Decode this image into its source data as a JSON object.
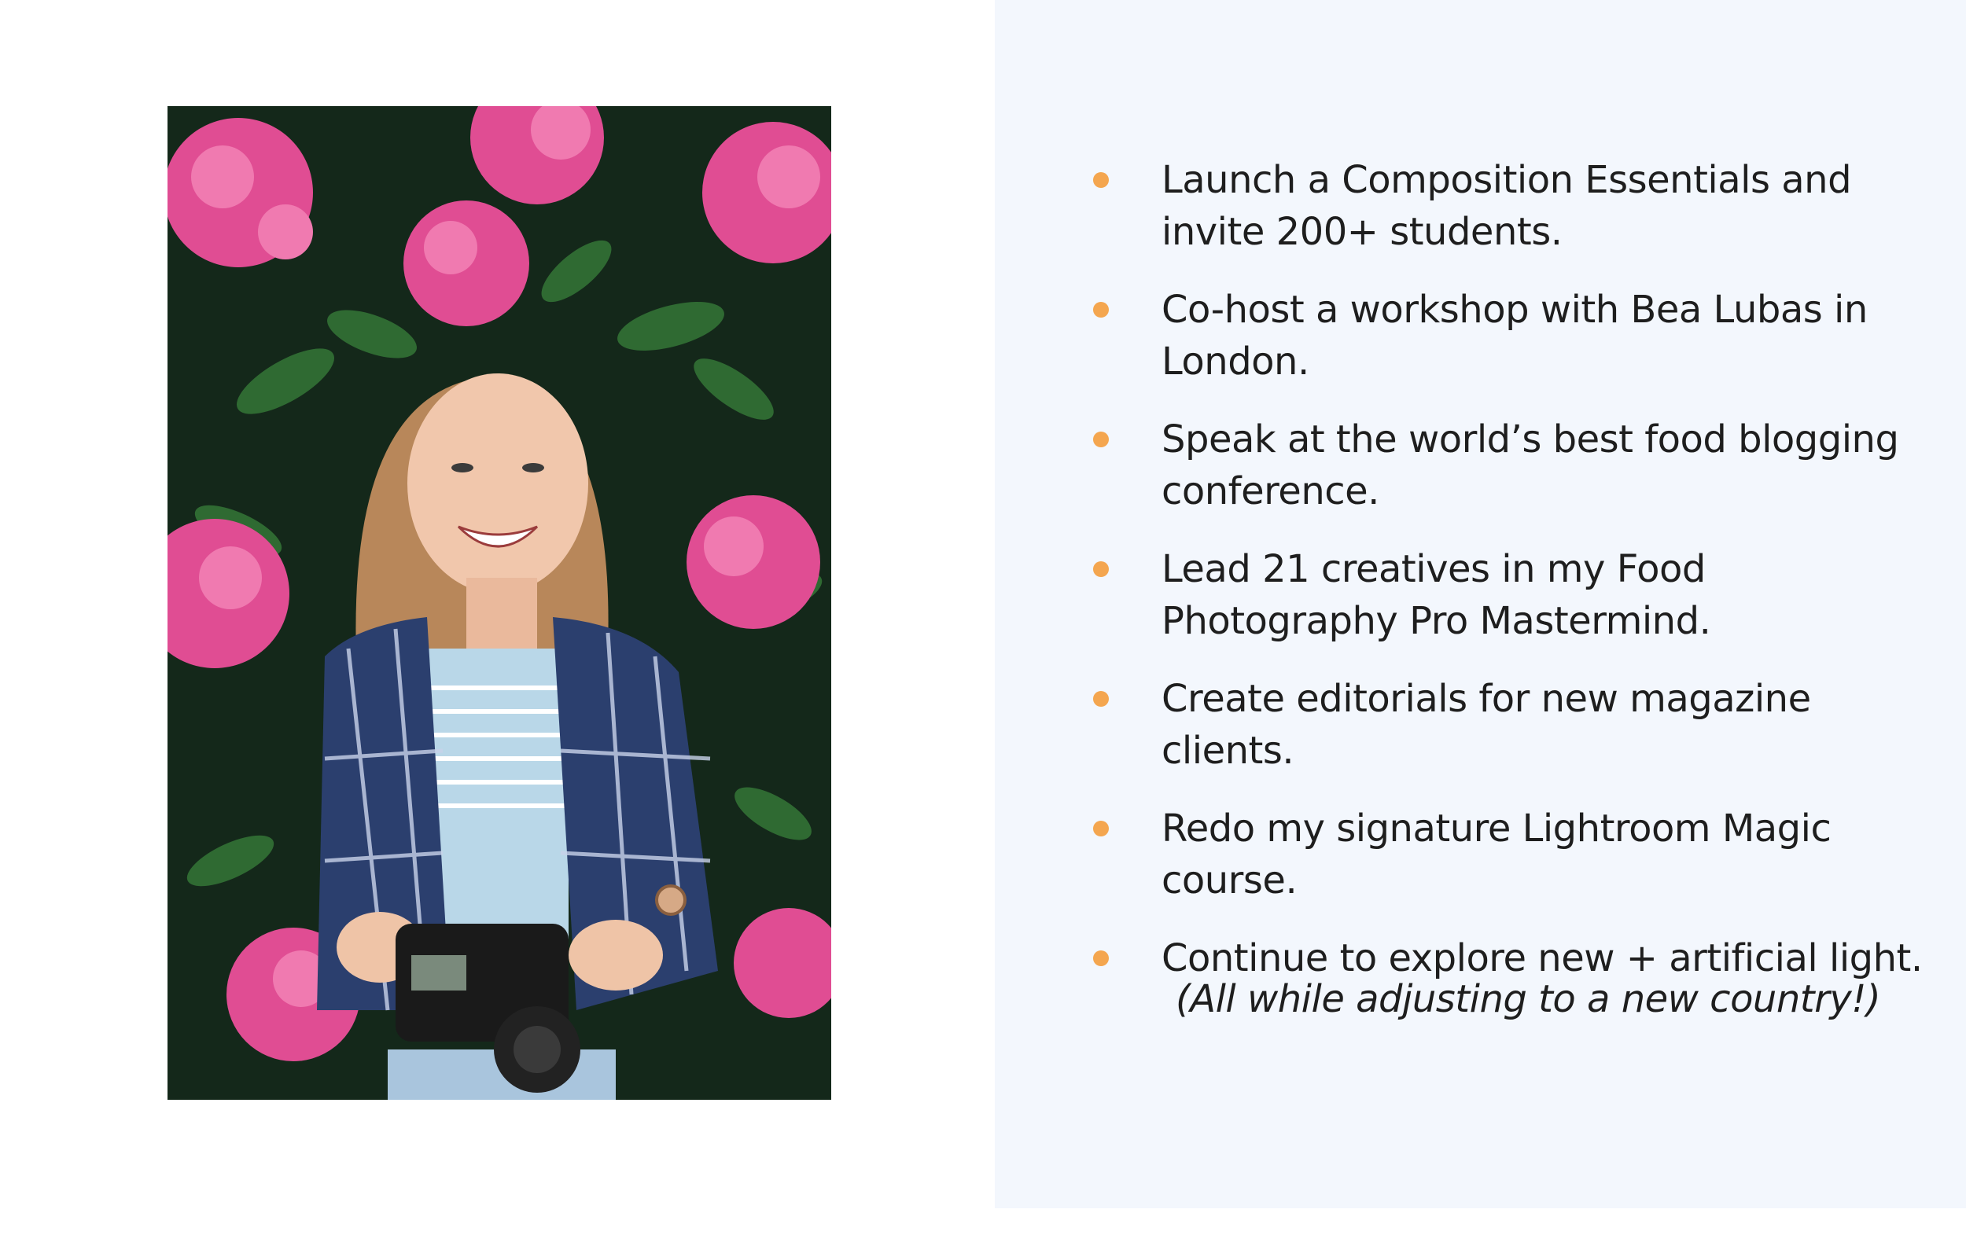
{
  "goals": [
    {
      "text": "Launch a Composition Essentials and invite 200+ students."
    },
    {
      "text": "Co-host a workshop with Bea Lubas in London."
    },
    {
      "text": "Speak at the world’s best food blogging conference."
    },
    {
      "text": "Lead 21 creatives in my Food Photography Pro Mastermind."
    },
    {
      "text": "Create editorials for new magazine clients."
    },
    {
      "text": "Redo my signature Lightroom Magic course."
    },
    {
      "text": "Continue to explore new + artificial light."
    }
  ],
  "note": "(All while adjusting to a new country!)",
  "colors": {
    "bullet": "#f4a64f",
    "panel_background": "#f3f7fd",
    "text": "#1e1e1e"
  }
}
